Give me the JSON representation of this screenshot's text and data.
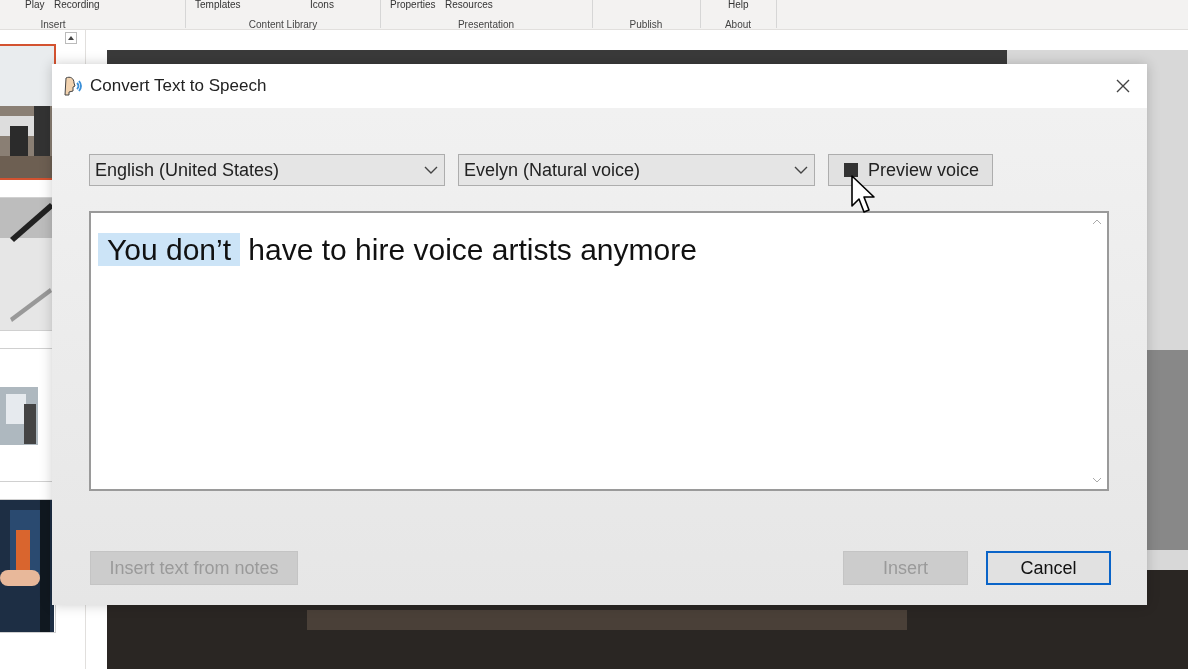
{
  "ribbon": {
    "top_labels": [
      "Play",
      "Recording",
      "Templates",
      "Icons",
      "Properties",
      "Resources",
      "Help"
    ],
    "groups": [
      "Insert",
      "Content Library",
      "Presentation",
      "Publish",
      "About"
    ]
  },
  "thumbnails": [
    {
      "kind": "picture",
      "selected": true
    },
    {
      "kind": "picture",
      "selected": false
    },
    {
      "kind": "picture",
      "selected": false
    },
    {
      "kind": "picture",
      "selected": false
    }
  ],
  "dialog": {
    "title": "Convert Text to Speech",
    "language": "English (United States)",
    "voice": "Evelyn (Natural voice)",
    "preview_button": {
      "label": "Preview voice",
      "playing": true
    },
    "text_segments": [
      {
        "text": "You don’t",
        "highlighted": true
      },
      {
        "text": " have to hire voice artists anymore",
        "highlighted": false
      }
    ],
    "buttons": [
      {
        "label": "Insert text from notes",
        "disabled": true,
        "focused": false
      },
      {
        "label": "Insert",
        "disabled": true,
        "focused": false
      },
      {
        "label": "Cancel",
        "disabled": false,
        "focused": true
      }
    ]
  }
}
